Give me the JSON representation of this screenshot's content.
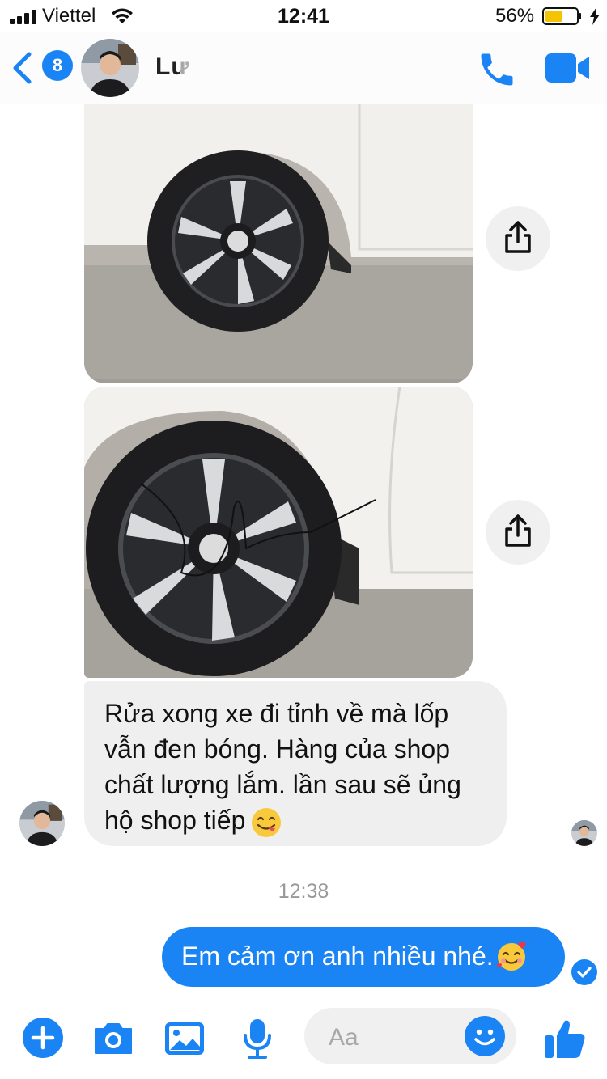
{
  "status_bar": {
    "carrier": "Viettel",
    "time": "12:41",
    "battery_percent": "56%",
    "battery_level": 0.56
  },
  "header": {
    "unread_count": "8",
    "contact_name": "Lư",
    "icons": [
      "back-chevron-icon",
      "phone-icon",
      "video-camera-icon"
    ],
    "accent_color": "#1b84f5"
  },
  "thread": {
    "photos": [
      {
        "description_icon": "car-wheel-photo-1"
      },
      {
        "description_icon": "car-wheel-photo-2"
      }
    ],
    "incoming_message": {
      "text": "Rửa xong xe đi tỉnh về mà lốp vẫn đen bóng. Hàng của shop chất lượng lắm. lần sau sẽ ủng hộ shop tiếp",
      "emoji": "face-savoring-food"
    },
    "timestamp": "12:38",
    "outgoing_message": {
      "text": "Em cảm ơn anh nhiều nhé.",
      "emoji": "smiling-face-with-hearts"
    }
  },
  "composer": {
    "placeholder": "Aa",
    "icons": [
      "plus-icon",
      "camera-icon",
      "gallery-icon",
      "microphone-icon",
      "emoji-icon",
      "thumbs-up-icon"
    ]
  }
}
